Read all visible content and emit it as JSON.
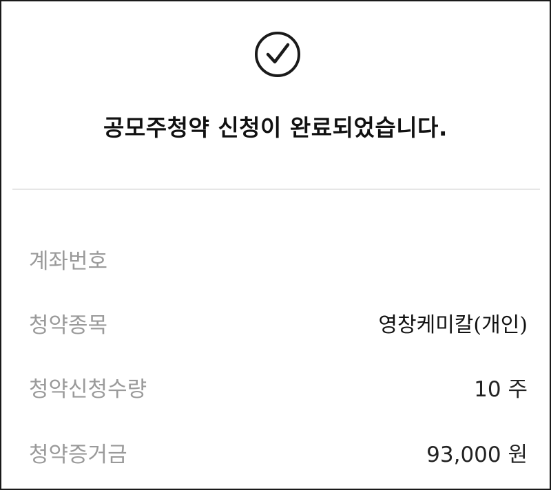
{
  "confirmation": {
    "icon": "check-circle-icon",
    "title": "공모주청약 신청이 완료되었습니다."
  },
  "details": [
    {
      "label": "계좌번호",
      "value": ""
    },
    {
      "label": "청약종목",
      "value": "영창케미칼(개인)"
    },
    {
      "label": "청약신청수량",
      "value": "10 주"
    },
    {
      "label": "청약증거금",
      "value": "93,000 원"
    }
  ]
}
